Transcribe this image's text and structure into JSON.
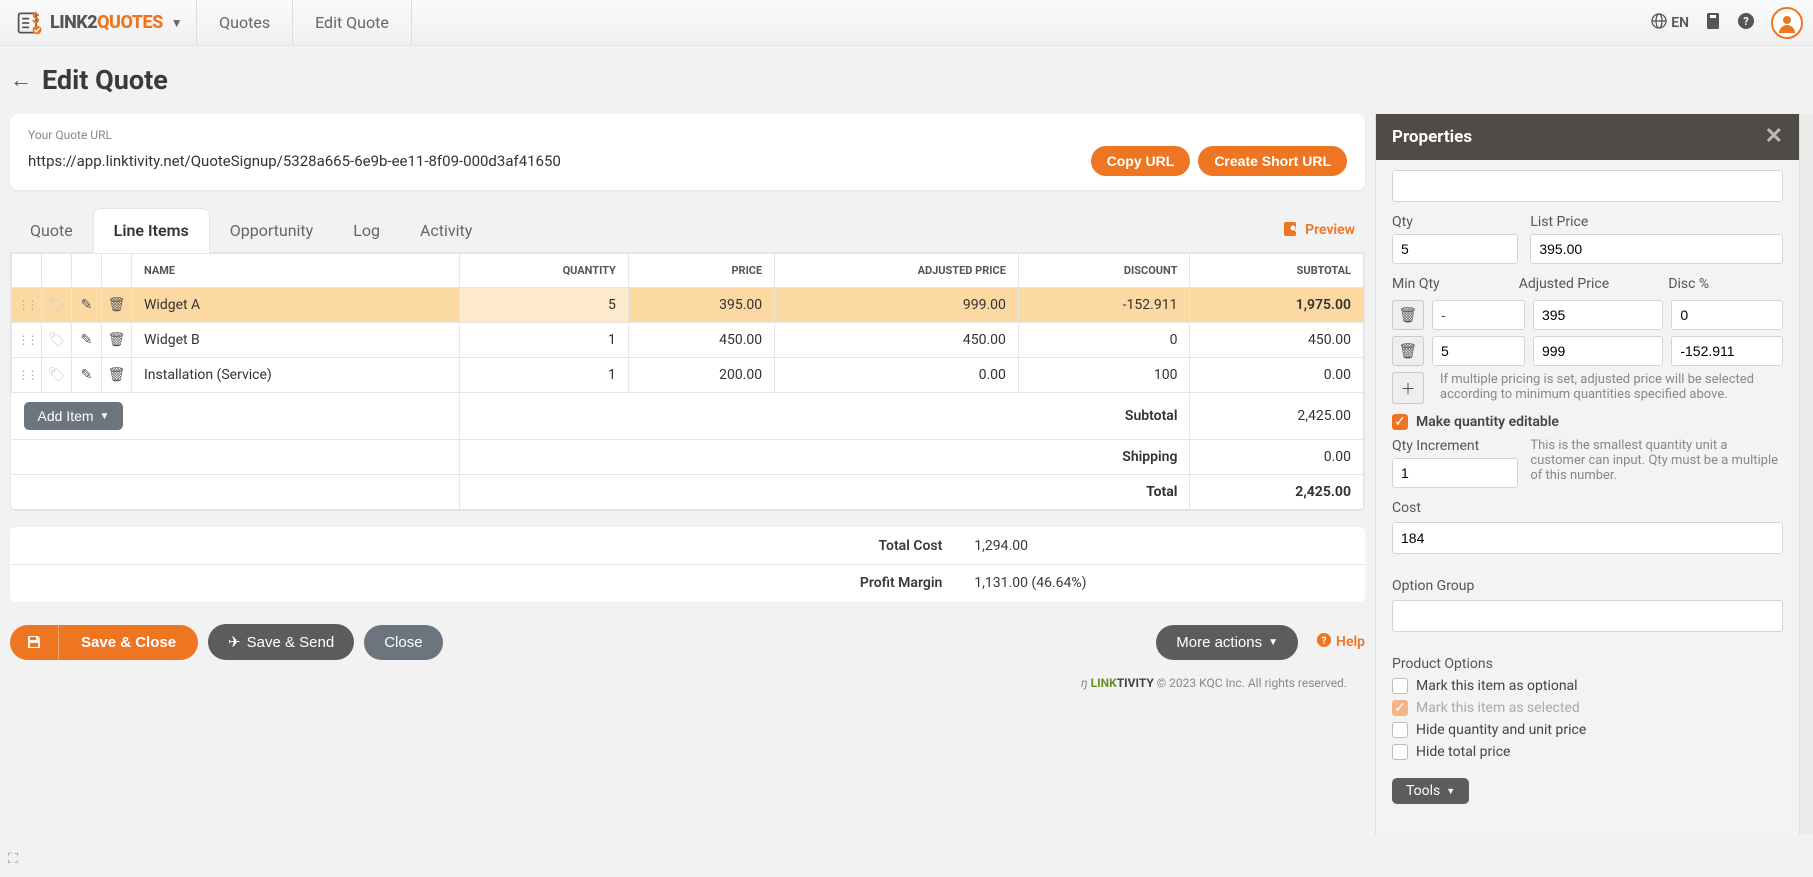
{
  "brand": {
    "part1": "LINK2",
    "part2": "QUOTES"
  },
  "breadcrumb": {
    "level1": "Quotes",
    "level2": "Edit Quote"
  },
  "top": {
    "lang": "EN"
  },
  "page": {
    "title": "Edit Quote"
  },
  "urlcard": {
    "label": "Your Quote URL",
    "url": "https://app.linktivity.net/QuoteSignup/5328a665-6e9b-ee11-8f09-000d3af41650",
    "copy_btn": "Copy URL",
    "short_btn": "Create Short URL"
  },
  "tabs": {
    "quote": "Quote",
    "line_items": "Line Items",
    "opportunity": "Opportunity",
    "log": "Log",
    "activity": "Activity",
    "preview": "Preview"
  },
  "table": {
    "headers": {
      "name": "NAME",
      "quantity": "QUANTITY",
      "price": "PRICE",
      "adjusted": "ADJUSTED PRICE",
      "discount": "DISCOUNT",
      "subtotal": "SUBTOTAL"
    },
    "rows": [
      {
        "name": "Widget A",
        "qty": "5",
        "price": "395.00",
        "adj": "999.00",
        "disc": "-152.911",
        "subtotal": "1,975.00"
      },
      {
        "name": "Widget B",
        "qty": "1",
        "price": "450.00",
        "adj": "450.00",
        "disc": "0",
        "subtotal": "450.00"
      },
      {
        "name": "Installation (Service)",
        "qty": "1",
        "price": "200.00",
        "adj": "0.00",
        "disc": "100",
        "subtotal": "0.00"
      }
    ],
    "add_item": "Add Item",
    "summary": {
      "subtotal_lbl": "Subtotal",
      "subtotal_val": "2,425.00",
      "shipping_lbl": "Shipping",
      "shipping_val": "0.00",
      "total_lbl": "Total",
      "total_val": "2,425.00"
    }
  },
  "summary2": {
    "cost_lbl": "Total Cost",
    "cost_val": "1,294.00",
    "margin_lbl": "Profit Margin",
    "margin_val": "1,131.00 (46.64%)"
  },
  "footer": {
    "save_close": "Save & Close",
    "save_send": "Save & Send",
    "close": "Close",
    "more_actions": "More actions",
    "help": "Help",
    "copyright": "© 2023 KQC Inc. All rights reserved.",
    "footer_brand_pre": "LINK",
    "footer_brand_suf": "TIVITY"
  },
  "properties": {
    "title": "Properties",
    "qty_lbl": "Qty",
    "qty_val": "5",
    "listprice_lbl": "List Price",
    "listprice_val": "395.00",
    "minqty_lbl": "Min Qty",
    "adj_lbl": "Adjusted Price",
    "disc_lbl": "Disc %",
    "tier1": {
      "min": "-",
      "adj": "395",
      "disc": "0"
    },
    "tier2": {
      "min": "5",
      "adj": "999",
      "disc": "-152.911"
    },
    "tier_note": "If multiple pricing is set, adjusted price will be selected according to minimum quantities specified above.",
    "make_editable": "Make quantity editable",
    "qty_inc_lbl": "Qty Increment",
    "qty_inc_val": "1",
    "qty_inc_note": "This is the smallest quantity unit a customer can input. Qty must be a multiple of this number.",
    "cost_lbl": "Cost",
    "cost_val": "184",
    "optgrp_lbl": "Option Group",
    "prodopt_lbl": "Product Options",
    "opt_optional": "Mark this item as optional",
    "opt_selected": "Mark this item as selected",
    "opt_hide_qty": "Hide quantity and unit price",
    "opt_hide_total": "Hide total price",
    "tools": "Tools"
  }
}
